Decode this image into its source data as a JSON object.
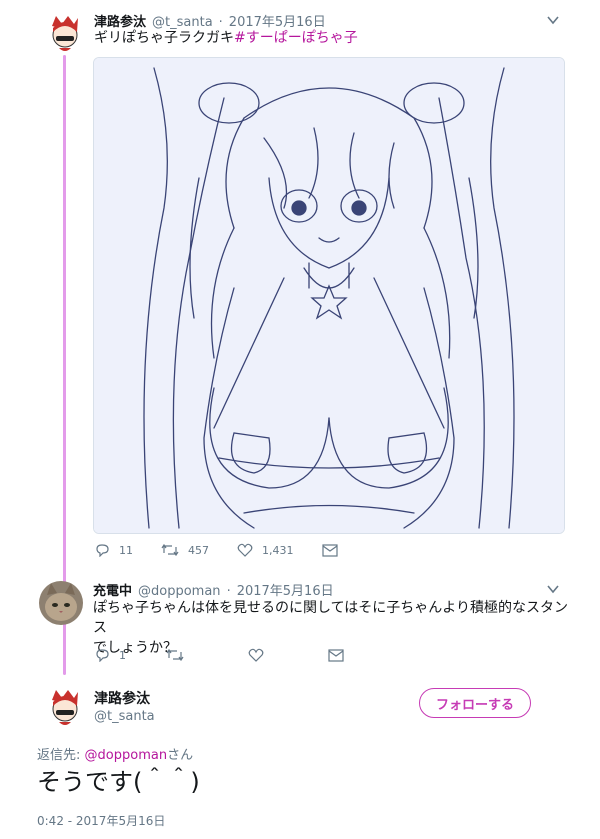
{
  "tweet1": {
    "display_name": "津路参汰",
    "handle": "@t_santa",
    "date": "2017年5月16日",
    "text_plain": "ギリぽちゃ子ラクガキ",
    "hashtag": "#すーぱーぽちゃ子",
    "reply_count": "11",
    "retweet_count": "457",
    "like_count": "1,431"
  },
  "tweet2": {
    "display_name": "充電中",
    "handle": "@doppoman",
    "date": "2017年5月16日",
    "text_line1": "ぽちゃ子ちゃんは体を見せるのに関してはそに子ちゃんより積極的なスタンス",
    "text_line2": "でしょうか？",
    "reply_count": "1"
  },
  "main_tweet": {
    "display_name": "津路参汰",
    "handle": "@t_santa",
    "follow_label": "フォローする",
    "reply_to_prefix": "返信先:",
    "reply_to_user": "@doppoman",
    "reply_to_suffix": "さん",
    "text": "そうです(＾＾)",
    "timestamp": "0:42 - 2017年5月16日"
  },
  "icons": [
    "chevron-down-icon",
    "reply-icon",
    "retweet-icon",
    "heart-icon",
    "dm-icon"
  ],
  "colors": {
    "accent": "#c63bb5",
    "thread_line": "#e39bea",
    "muted": "#657786"
  }
}
